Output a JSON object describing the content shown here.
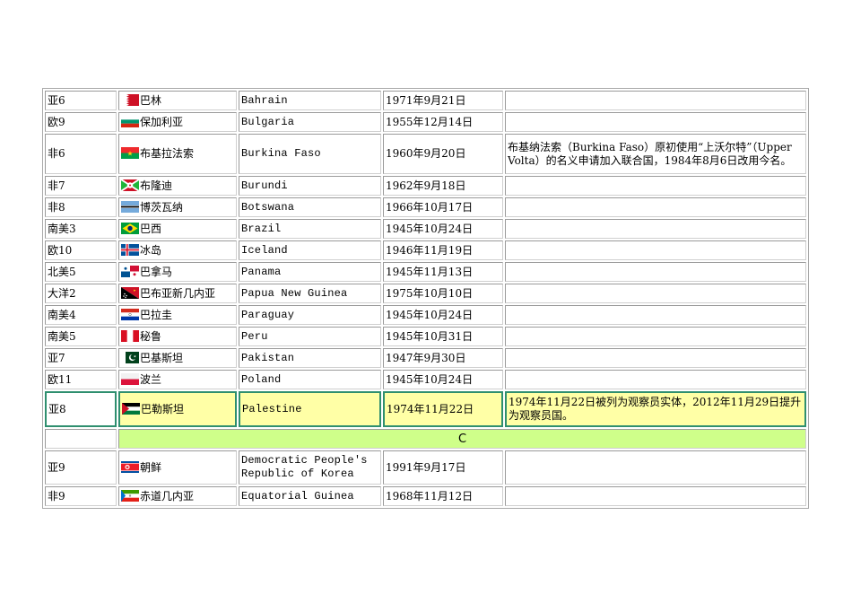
{
  "rows": [
    {
      "region": "亚6",
      "cn": "巴林",
      "en": "Bahrain",
      "date": "1971年9月21日",
      "note": "",
      "flag": "bahrain-flag-icon"
    },
    {
      "region": "欧9",
      "cn": "保加利亚",
      "en": "Bulgaria",
      "date": "1955年12月14日",
      "note": "",
      "flag": "bulgaria-flag-icon"
    },
    {
      "region": "非6",
      "cn": "布基拉法索",
      "en": "Burkina Faso",
      "date": "1960年9月20日",
      "note": "布基纳法索（Burkina Faso）原初使用“上沃尔特”（Upper Volta）的名义申请加入联合国，1984年8月6日改用今名。",
      "flag": "burkina-faso-flag-icon"
    },
    {
      "region": "非7",
      "cn": "布隆迪",
      "en": "Burundi",
      "date": "1962年9月18日",
      "note": "",
      "flag": "burundi-flag-icon"
    },
    {
      "region": "非8",
      "cn": "博茨瓦纳",
      "en": "Botswana",
      "date": "1966年10月17日",
      "note": "",
      "flag": "botswana-flag-icon"
    },
    {
      "region": "南美3",
      "cn": "巴西",
      "en": "Brazil",
      "date": "1945年10月24日",
      "note": "",
      "flag": "brazil-flag-icon"
    },
    {
      "region": "欧10",
      "cn": "冰岛",
      "en": "Iceland",
      "date": "1946年11月19日",
      "note": "",
      "flag": "iceland-flag-icon"
    },
    {
      "region": "北美5",
      "cn": "巴拿马",
      "en": "Panama",
      "date": "1945年11月13日",
      "note": "",
      "flag": "panama-flag-icon"
    },
    {
      "region": "大洋2",
      "cn": "巴布亚新几内亚",
      "en": "Papua New Guinea",
      "date": "1975年10月10日",
      "note": "",
      "flag": "papua-new-guinea-flag-icon"
    },
    {
      "region": "南美4",
      "cn": "巴拉圭",
      "en": "Paraguay",
      "date": "1945年10月24日",
      "note": "",
      "flag": "paraguay-flag-icon"
    },
    {
      "region": "南美5",
      "cn": "秘鲁",
      "en": "Peru",
      "date": "1945年10月31日",
      "note": "",
      "flag": "peru-flag-icon"
    },
    {
      "region": "亚7",
      "cn": "巴基斯坦",
      "en": "Pakistan",
      "date": "1947年9月30日",
      "note": "",
      "flag": "pakistan-flag-icon"
    },
    {
      "region": "欧11",
      "cn": "波兰",
      "en": "Poland",
      "date": "1945年10月24日",
      "note": "",
      "flag": "poland-flag-icon"
    },
    {
      "region": "亚8",
      "cn": "巴勒斯坦",
      "en": "Palestine",
      "date": "1974年11月22日",
      "note": "1974年11月22日被列为观察员实体，2012年11月29日提升为观察员国。",
      "flag": "palestine-flag-icon"
    }
  ],
  "section_letter": "C",
  "rows_c": [
    {
      "region": "亚9",
      "cn": "朝鲜",
      "en": "Democratic People's Republic of Korea",
      "date": "1991年9月17日",
      "note": "",
      "flag": "north-korea-flag-icon"
    },
    {
      "region": "非9",
      "cn": "赤道几内亚",
      "en": "Equatorial Guinea",
      "date": "1968年11月12日",
      "note": "",
      "flag": "equatorial-guinea-flag-icon"
    }
  ]
}
